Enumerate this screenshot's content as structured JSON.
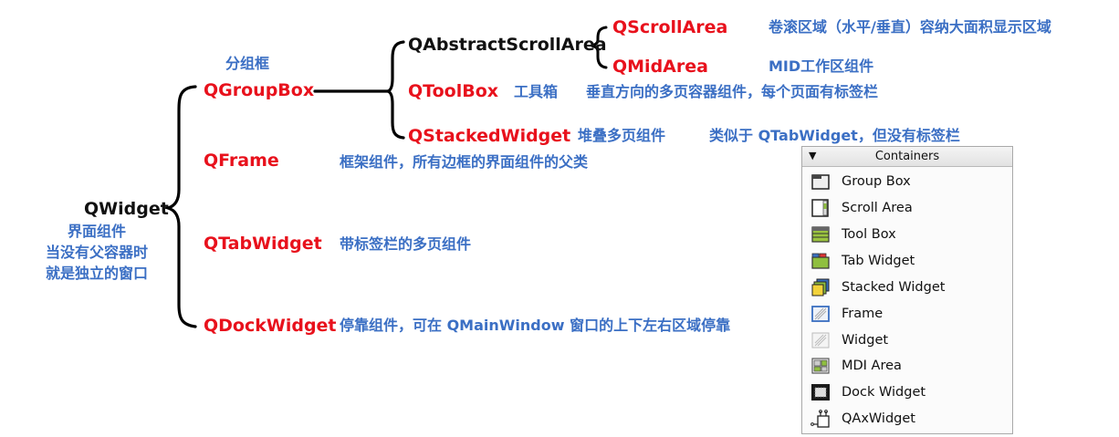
{
  "root": {
    "name": "QWidget",
    "desc_lines": [
      "界面组件",
      "当没有父容器时",
      "就是独立的窗口"
    ]
  },
  "groupbox": {
    "desc": "分组框",
    "name": "QGroupBox"
  },
  "abstract_scroll_area": {
    "name": "QAbstractScrollArea",
    "scroll_area": {
      "name": "QScrollArea",
      "desc": "卷滚区域（水平/垂直）容纳大面积显示区域"
    },
    "mdi_area": {
      "name": "QMidArea",
      "desc": "MID工作区组件"
    }
  },
  "toolbox": {
    "name": "QToolBox",
    "desc_a": "工具箱",
    "desc_b": "垂直方向的多页容器组件，每个页面有标签栏"
  },
  "stacked": {
    "name": "QStackedWidget",
    "desc_a": "堆叠多页组件",
    "desc_b": "类似于 QTabWidget，但没有标签栏"
  },
  "frame": {
    "name": "QFrame",
    "desc": "框架组件，所有边框的界面组件的父类"
  },
  "tabwidget": {
    "name": "QTabWidget",
    "desc": "带标签栏的多页组件"
  },
  "dock": {
    "name": "QDockWidget",
    "desc": "停靠组件，可在 QMainWindow 窗口的上下左右区域停靠"
  },
  "containers_panel": {
    "header": "Containers",
    "items": [
      {
        "label": "Group Box",
        "icon": "group-box-icon"
      },
      {
        "label": "Scroll Area",
        "icon": "scroll-area-icon"
      },
      {
        "label": "Tool Box",
        "icon": "tool-box-icon"
      },
      {
        "label": "Tab Widget",
        "icon": "tab-widget-icon"
      },
      {
        "label": "Stacked Widget",
        "icon": "stacked-widget-icon"
      },
      {
        "label": "Frame",
        "icon": "frame-icon"
      },
      {
        "label": "Widget",
        "icon": "widget-icon"
      },
      {
        "label": "MDI Area",
        "icon": "mdi-area-icon"
      },
      {
        "label": "Dock Widget",
        "icon": "dock-widget-icon"
      },
      {
        "label": "QAxWidget",
        "icon": "qaxwidget-icon"
      }
    ]
  },
  "colors": {
    "class_red": "#e8111c",
    "desc_blue": "#3b6fc4",
    "text_black": "#111111"
  }
}
